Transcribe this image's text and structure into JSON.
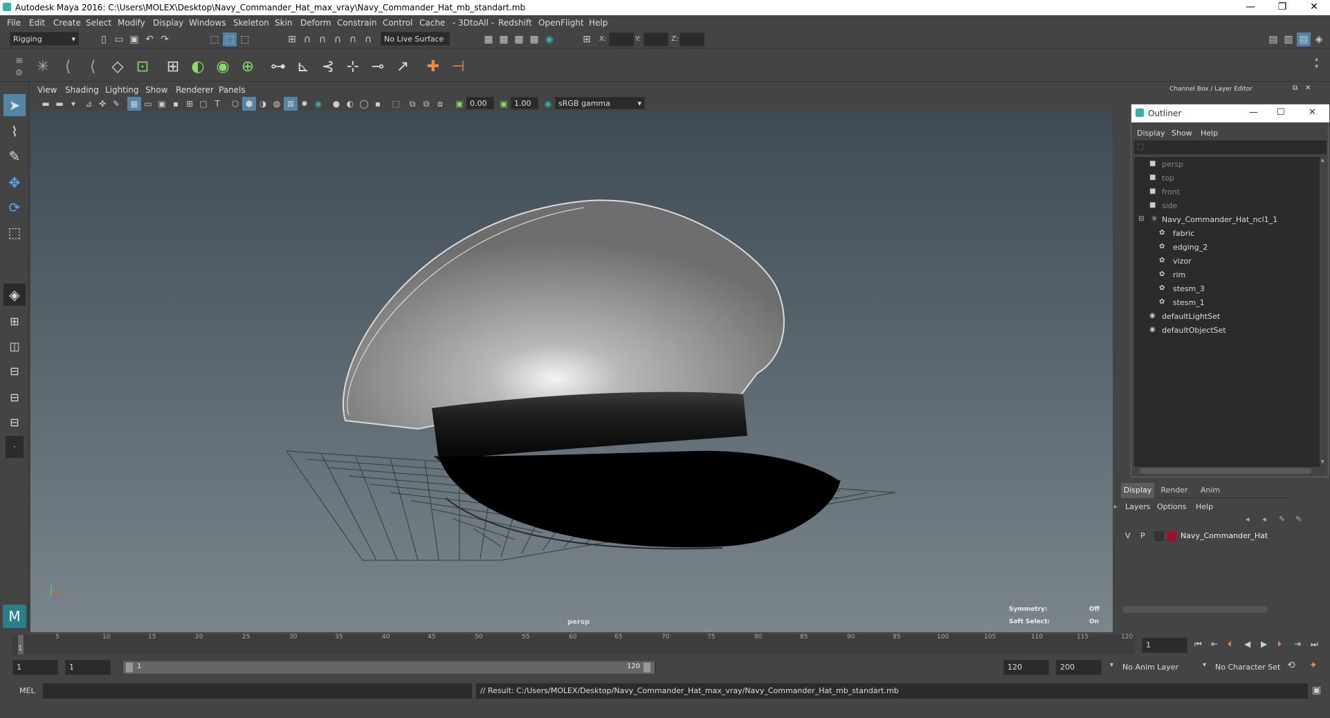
{
  "title": "Autodesk Maya 2016: C:\\Users\\MOLEX\\Desktop\\Navy_Commander_Hat_max_vray\\Navy_Commander_Hat_mb_standart.mb",
  "window_controls": {
    "min": "—",
    "restore": "❐",
    "close": "✕"
  },
  "menus": [
    "File",
    "Edit",
    "Create",
    "Select",
    "Modify",
    "Display",
    "Windows",
    "Skeleton",
    "Skin",
    "Deform",
    "Constrain",
    "Control",
    "Cache",
    "- 3DtoAll -",
    "Redshift",
    "OpenFlight",
    "Help"
  ],
  "status": {
    "mode": "Rigging",
    "live_surface": "No Live Surface",
    "x_label": "X:",
    "y_label": "Y:",
    "z_label": "Z:"
  },
  "panel_menus": [
    "View",
    "Shading",
    "Lighting",
    "Show",
    "Renderer",
    "Panels"
  ],
  "panel_tools": {
    "exposure": "0.00",
    "gamma": "1.00",
    "color_space": "sRGB gamma"
  },
  "viewport": {
    "camera": "persp",
    "symmetry_label": "Symmetry:",
    "symmetry_value": "Off",
    "soft_select_label": "Soft Select:",
    "soft_select_value": "On"
  },
  "channel_box_title": "Channel Box / Layer Editor",
  "outliner": {
    "title": "Outliner",
    "menus": [
      "Display",
      "Show",
      "Help"
    ],
    "items": [
      {
        "label": "persp",
        "dim": true
      },
      {
        "label": "top",
        "dim": true
      },
      {
        "label": "front",
        "dim": true
      },
      {
        "label": "side",
        "dim": true
      },
      {
        "label": "Navy_Commander_Hat_ncl1_1",
        "dim": false
      },
      {
        "label": "fabric",
        "dim": false
      },
      {
        "label": "edging_2",
        "dim": false
      },
      {
        "label": "vizor",
        "dim": false
      },
      {
        "label": "rim",
        "dim": false
      },
      {
        "label": "stesm_3",
        "dim": false
      },
      {
        "label": "stesm_1",
        "dim": false
      },
      {
        "label": "defaultLightSet",
        "dim": false
      },
      {
        "label": "defaultObjectSet",
        "dim": false
      }
    ]
  },
  "layer_editor": {
    "tabs": [
      "Display",
      "Render",
      "Anim"
    ],
    "menus": [
      "Layers",
      "Options",
      "Help"
    ],
    "layer": {
      "v": "V",
      "p": "P",
      "name": "Navy_Commander_Hat",
      "color": "#a0102a"
    }
  },
  "timeline": {
    "ticks": [
      "5",
      "10",
      "15",
      "20",
      "25",
      "30",
      "35",
      "40",
      "45",
      "50",
      "55",
      "60",
      "65",
      "70",
      "75",
      "80",
      "85",
      "90",
      "95",
      "100",
      "105",
      "110",
      "115",
      "120"
    ],
    "current": "1",
    "current_field": "1"
  },
  "range": {
    "start": "1",
    "anim_start": "1",
    "slider_start": "1",
    "slider_end": "120",
    "end": "120",
    "anim_end": "200",
    "anim_layer": "No Anim Layer",
    "char_set": "No Character Set"
  },
  "cmd": {
    "label": "MEL",
    "result": "// Result: C:/Users/MOLEX/Desktop/Navy_Commander_Hat_max_vray/Navy_Commander_Hat_mb_standart.mb"
  },
  "colors": {
    "accent": "#2fb5a8"
  }
}
